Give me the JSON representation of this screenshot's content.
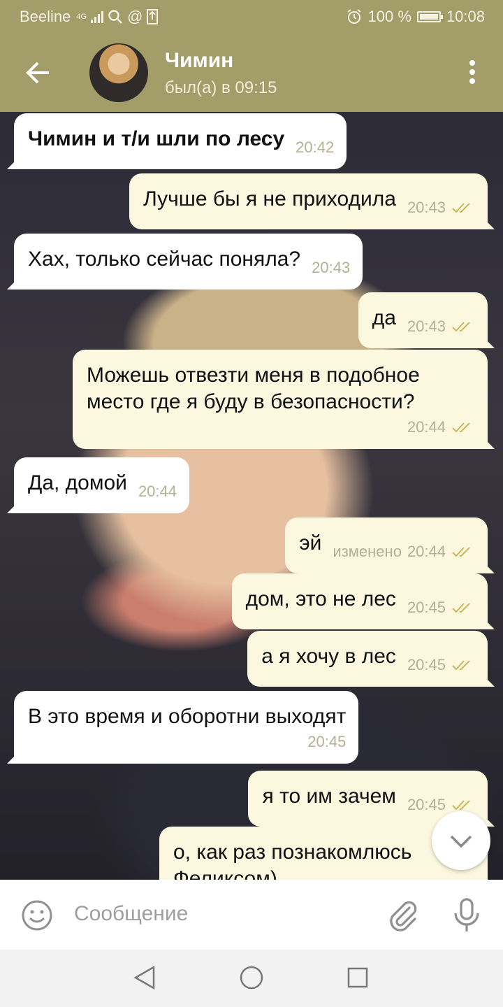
{
  "status_bar": {
    "carrier": "Beeline",
    "network": "4G",
    "battery": "100 %",
    "time": "10:08"
  },
  "header": {
    "contact_name": "Чимин",
    "last_seen": "был(а) в 09:15"
  },
  "messages": [
    {
      "text": "Чимин и т/и шли по лесу",
      "time": "20:42",
      "side": "in"
    },
    {
      "text": "Лучше бы я не приходила",
      "time": "20:43",
      "side": "out"
    },
    {
      "text": "Хах, только сейчас поняла?",
      "time": "20:43",
      "side": "in"
    },
    {
      "text": "да",
      "time": "20:43",
      "side": "out"
    },
    {
      "text_line1": "Можешь отвезти меня в подобное",
      "text_line2": "место где я буду в безопасности?",
      "time": "20:44",
      "side": "out"
    },
    {
      "text": "Да, домой",
      "time": "20:44",
      "side": "in"
    },
    {
      "text": "эй",
      "edited": "изменено",
      "time": "20:44",
      "side": "out"
    },
    {
      "text": "дом, это не лес",
      "time": "20:45",
      "side": "out"
    },
    {
      "text": "а я хочу в лес",
      "time": "20:45",
      "side": "out"
    },
    {
      "text": "В это время и оборотни выходят",
      "time": "20:45",
      "side": "in"
    },
    {
      "text": "я то им зачем",
      "time": "20:45",
      "side": "out"
    },
    {
      "text_line1": "о, как раз познакомлюсь",
      "text_line2": "Феликсом)",
      "side": "out"
    }
  ],
  "input": {
    "placeholder": "Сообщение"
  },
  "colors": {
    "header": "#a39d69",
    "outgoing_bubble": "#fcf8e0",
    "incoming_bubble": "#ffffff",
    "check_marks": "#c8b85a"
  },
  "icons": {
    "back": "arrow-left-icon",
    "menu": "more-vertical-icon",
    "emoji": "smile-icon",
    "attach": "paperclip-icon",
    "mic": "microphone-icon",
    "scroll": "chevron-down-icon"
  }
}
